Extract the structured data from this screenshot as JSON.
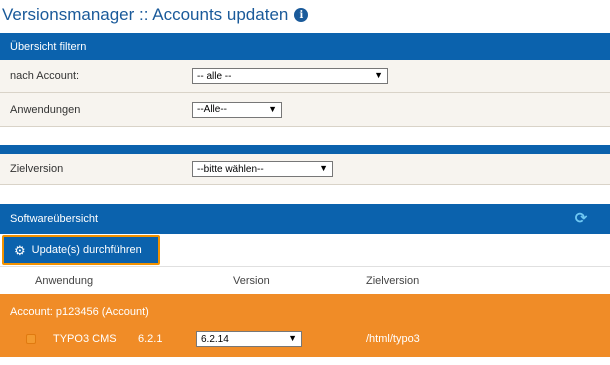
{
  "page": {
    "title": "Versionsmanager :: Accounts updaten",
    "info_icon": "i"
  },
  "filter": {
    "heading": "Übersicht filtern",
    "account_label": "nach Account:",
    "account_value": "-- alle --",
    "apps_label": "Anwendungen",
    "apps_value": "--Alle--",
    "target_label": "Zielversion",
    "target_value": "--bitte wählen--"
  },
  "software": {
    "heading": "Softwareübersicht",
    "refresh_icon": "refresh-icon",
    "update_button": "Update(s) durchführen",
    "columns": [
      "Anwendung",
      "Version",
      "Zielversion"
    ],
    "account": {
      "title": "Account: p123456 (Account)",
      "app_name": "TYPO3 CMS",
      "version": "6.2.1",
      "target_version": "6.2.14",
      "path": "/html/typo3"
    }
  },
  "colors": {
    "primary": "#0b62ad",
    "accent": "#f39200",
    "account_bg": "#f08c27",
    "title": "#1a5a9a"
  }
}
